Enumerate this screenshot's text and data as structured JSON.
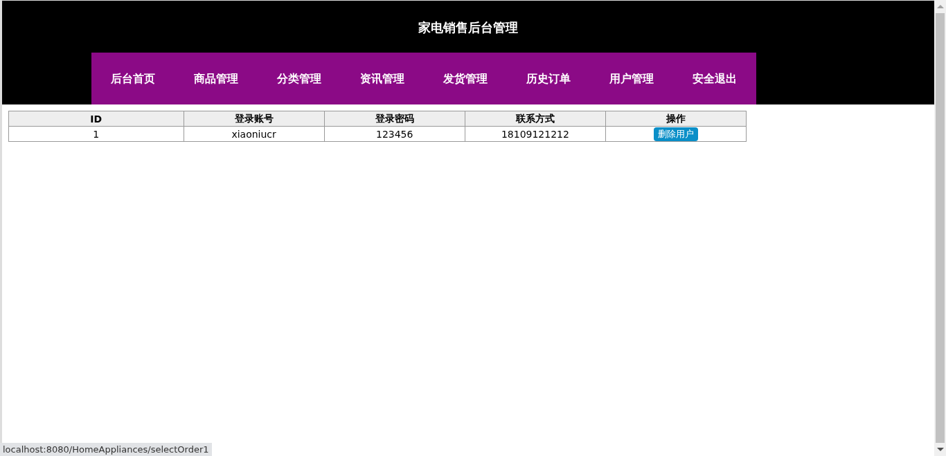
{
  "header": {
    "title": "家电销售后台管理"
  },
  "nav": [
    "后台首页",
    "商品管理",
    "分类管理",
    "资讯管理",
    "发货管理",
    "历史订单",
    "用户管理",
    "安全退出"
  ],
  "table": {
    "columns": [
      "ID",
      "登录账号",
      "登录密码",
      "联系方式",
      "操作"
    ],
    "rows": [
      {
        "cells": [
          "1",
          "xiaoniucr",
          "123456",
          "18109121212"
        ],
        "action": "删除用户"
      }
    ]
  },
  "status_bar": "localhost:8080/HomeAppliances/selectOrder1"
}
